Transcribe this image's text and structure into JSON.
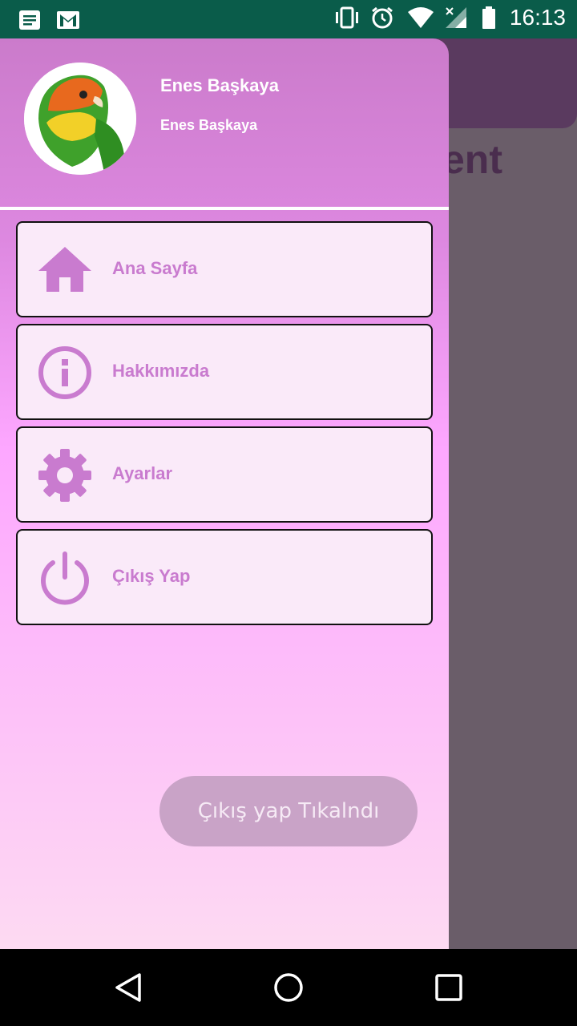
{
  "status_bar": {
    "time": "16:13",
    "icons_left": [
      "notes-icon",
      "gmail-icon"
    ],
    "icons_right": [
      "vibrate-icon",
      "alarm-icon",
      "wifi-icon",
      "signal-icon",
      "battery-icon"
    ]
  },
  "background": {
    "title_fragment": "ent"
  },
  "drawer": {
    "header": {
      "name": "Enes Başkaya",
      "subtitle": "Enes Başkaya",
      "avatar_icon": "parrot-avatar"
    },
    "items": [
      {
        "label": "Ana Sayfa",
        "icon": "home-icon"
      },
      {
        "label": "Hakkımızda",
        "icon": "info-icon"
      },
      {
        "label": "Ayarlar",
        "icon": "gear-icon"
      },
      {
        "label": "Çıkış Yap",
        "icon": "power-icon"
      }
    ],
    "accent_color": "#c97bcf"
  },
  "toast": {
    "text": "Çıkış yap Tıkalndı"
  },
  "nav_bar": {
    "buttons": [
      "back-icon",
      "home-circle-icon",
      "recents-icon"
    ]
  }
}
